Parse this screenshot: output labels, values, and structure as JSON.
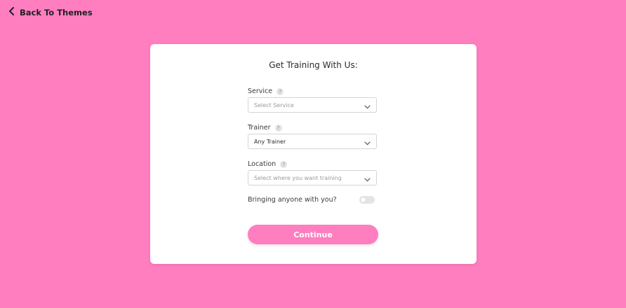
{
  "nav": {
    "back_label": "Back To Themes"
  },
  "form": {
    "title": "Get Training With Us:",
    "service": {
      "label": "Service",
      "placeholder": "Select Service",
      "help": "?"
    },
    "trainer": {
      "label": "Trainer",
      "value": "Any Trainer",
      "help": "?"
    },
    "location": {
      "label": "Location",
      "placeholder": "Select where you want training",
      "help": "?"
    },
    "companion": {
      "label": "Bringing anyone with you?",
      "enabled": false
    },
    "continue_label": "Continue"
  },
  "colors": {
    "background": "#ff7ebf",
    "accent": "#ff7ebf",
    "card": "#ffffff"
  },
  "icons": {
    "back": "chevron-left-icon",
    "dropdown": "chevron-down-icon"
  }
}
